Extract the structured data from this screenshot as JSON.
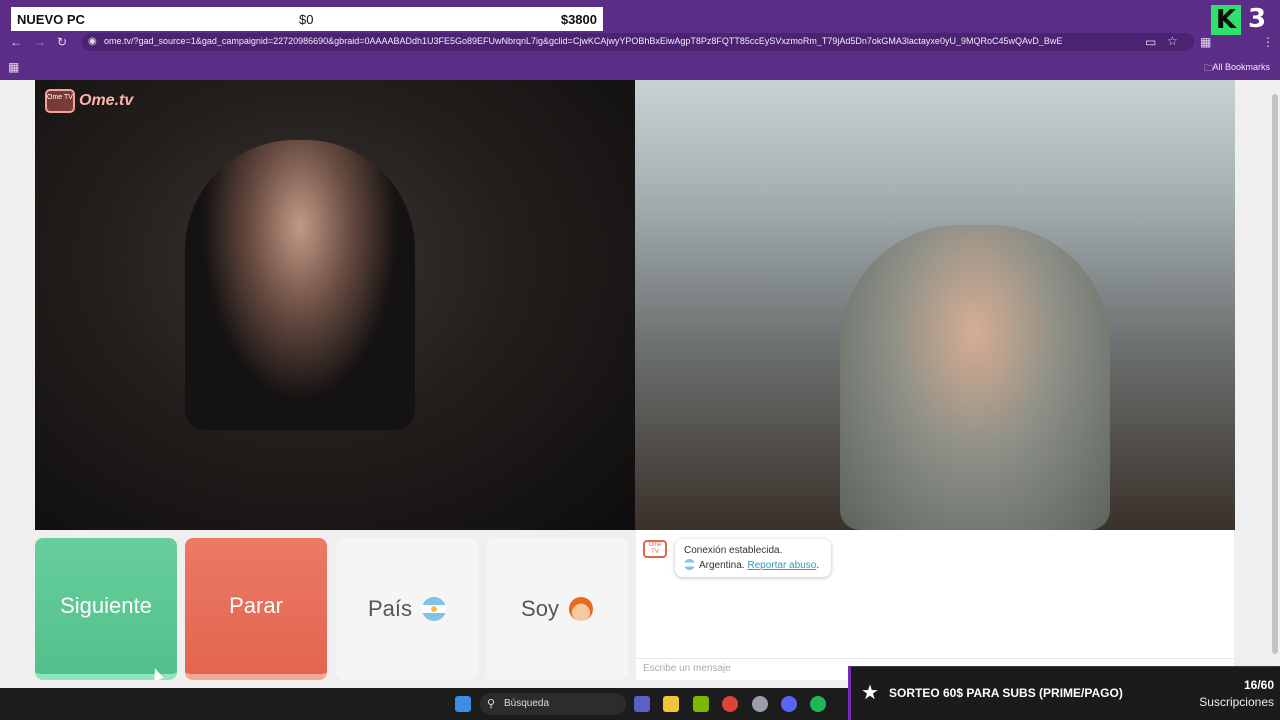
{
  "overlay": {
    "goal_label": "NUEVO PC",
    "goal_current": "$0",
    "goal_target": "$3800",
    "channel_logo": "K",
    "channel_number": "3"
  },
  "browser": {
    "url": "ome.tv/?gad_source=1&gad_campaignid=22720986690&gbraid=0AAAABADdh1U3FE5Go89EFUwNbrqnL7ig&gclid=CjwKCAjwyYPOBhBxEiwAgpT8Pz8FQTT85ccEySVxzmoRm_T79jAd5Dn7okGMA3lactayxe0yU_9MQRoC45wQAvD_BwE",
    "bookmarks_label": "All Bookmarks"
  },
  "site": {
    "logo_text": "Ome.tv",
    "logo_small": "Ome TV"
  },
  "controls": {
    "next": "Siguiente",
    "stop": "Parar",
    "country": "País",
    "soy": "Soy"
  },
  "chat": {
    "status": "Conexión establecida.",
    "country": "Argentina.",
    "report": "Reportar abuso",
    "placeholder": "Escribe un mensaje"
  },
  "taskbar": {
    "search": "Búsqueda"
  },
  "subs": {
    "title": "SORTEO 60$ PARA SUBS (PRIME/PAGO)",
    "count": "16/60",
    "label": "Suscripciones"
  }
}
